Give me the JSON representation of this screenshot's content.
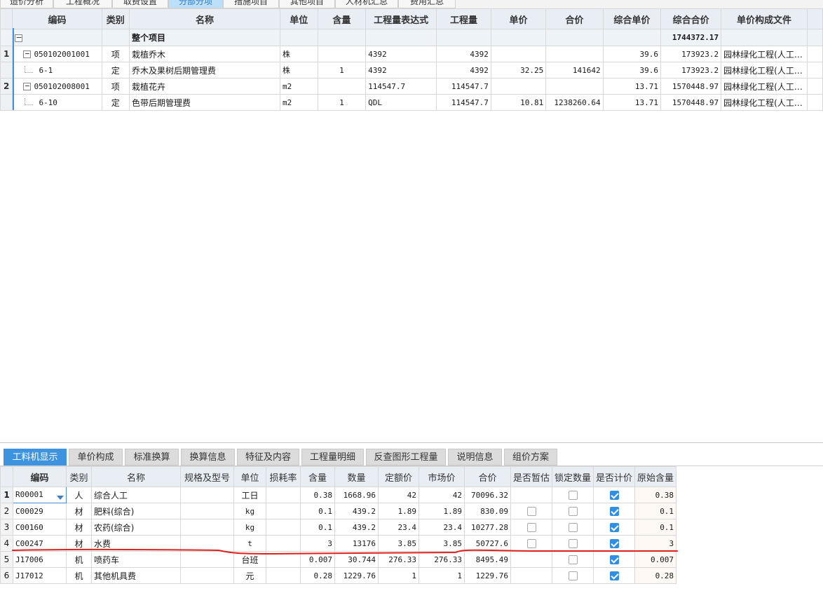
{
  "top_tabs": [
    {
      "label": "造价分析",
      "active": false
    },
    {
      "label": "工程概况",
      "active": false
    },
    {
      "label": "取费设置",
      "active": false
    },
    {
      "label": "分部分项",
      "active": true
    },
    {
      "label": "措施项目",
      "active": false
    },
    {
      "label": "其他项目",
      "active": false
    },
    {
      "label": "人材机汇总",
      "active": false
    },
    {
      "label": "费用汇总",
      "active": false
    }
  ],
  "main_grid": {
    "columns": [
      "编码",
      "类别",
      "名称",
      "单位",
      "含量",
      "工程量表达式",
      "工程量",
      "单价",
      "合价",
      "综合单价",
      "综合合价",
      "单价构成文件"
    ],
    "total_row": {
      "toggle": "−",
      "name": "整个项目",
      "total": "1744372.17"
    },
    "rows": [
      {
        "num": "1",
        "toggle": "−",
        "code": "050102001001",
        "type": "项",
        "name": "栽植乔木",
        "unit": "株",
        "content": "",
        "expr": "4392",
        "qty": "4392",
        "price": "",
        "amount": "",
        "unit_price": "39.6",
        "total": "173923.2",
        "file": "园林绿化工程(人工…"
      },
      {
        "num": "",
        "toggle": "",
        "code": "6-1",
        "type": "定",
        "name": "乔木及果树后期管理费",
        "unit": "株",
        "content": "1",
        "expr": "4392",
        "qty": "4392",
        "price": "32.25",
        "amount": "141642",
        "unit_price": "39.6",
        "total": "173923.2",
        "file": "园林绿化工程(人工…"
      },
      {
        "num": "2",
        "toggle": "−",
        "code": "050102008001",
        "type": "项",
        "name": "栽植花卉",
        "unit": "m2",
        "content": "",
        "expr": "114547.7",
        "qty": "114547.7",
        "price": "",
        "amount": "",
        "unit_price": "13.71",
        "total": "1570448.97",
        "file": "园林绿化工程(人工…"
      },
      {
        "num": "",
        "toggle": "",
        "code": "6-10",
        "type": "定",
        "name": "色带后期管理费",
        "unit": "m2",
        "content": "1",
        "expr": "QDL",
        "qty": "114547.7",
        "price": "10.81",
        "amount": "1238260.64",
        "unit_price": "13.71",
        "total": "1570448.97",
        "file": "园林绿化工程(人工…"
      }
    ]
  },
  "bottom_tabs": [
    {
      "label": "工料机显示",
      "active": true
    },
    {
      "label": "单价构成",
      "active": false
    },
    {
      "label": "标准换算",
      "active": false
    },
    {
      "label": "换算信息",
      "active": false
    },
    {
      "label": "特征及内容",
      "active": false
    },
    {
      "label": "工程量明细",
      "active": false
    },
    {
      "label": "反查图形工程量",
      "active": false
    },
    {
      "label": "说明信息",
      "active": false
    },
    {
      "label": "组价方案",
      "active": false
    }
  ],
  "detail_grid": {
    "columns": [
      "编码",
      "类别",
      "名称",
      "规格及型号",
      "单位",
      "损耗率",
      "含量",
      "数量",
      "定额价",
      "市场价",
      "合价",
      "是否暂估",
      "锁定数量",
      "是否计价",
      "原始含量"
    ],
    "rows": [
      {
        "num": "1",
        "code": "R00001",
        "type": "人",
        "name": "综合人工",
        "spec": "",
        "unit": "工日",
        "loss": "",
        "content": "0.38",
        "qty": "1668.96",
        "quota": "42",
        "market": "42",
        "amount": "70096.32",
        "est": null,
        "lock": false,
        "priced": true,
        "orig": "0.38"
      },
      {
        "num": "2",
        "code": "C00029",
        "type": "材",
        "name": "肥料(综合)",
        "spec": "",
        "unit": "kg",
        "loss": "",
        "content": "0.1",
        "qty": "439.2",
        "quota": "1.89",
        "market": "1.89",
        "amount": "830.09",
        "est": false,
        "lock": false,
        "priced": true,
        "orig": "0.1"
      },
      {
        "num": "3",
        "code": "C00160",
        "type": "材",
        "name": "农药(综合)",
        "spec": "",
        "unit": "kg",
        "loss": "",
        "content": "0.1",
        "qty": "439.2",
        "quota": "23.4",
        "market": "23.4",
        "amount": "10277.28",
        "est": false,
        "lock": false,
        "priced": true,
        "orig": "0.1"
      },
      {
        "num": "4",
        "code": "C00247",
        "type": "材",
        "name": "水费",
        "spec": "",
        "unit": "t",
        "loss": "",
        "content": "3",
        "qty": "13176",
        "quota": "3.85",
        "market": "3.85",
        "amount": "50727.6",
        "est": false,
        "lock": false,
        "priced": true,
        "orig": "3"
      },
      {
        "num": "5",
        "code": "J17006",
        "type": "机",
        "name": "喷药车",
        "spec": "",
        "unit": "台班",
        "loss": "",
        "content": "0.007",
        "qty": "30.744",
        "quota": "276.33",
        "market": "276.33",
        "amount": "8495.49",
        "est": null,
        "lock": false,
        "priced": true,
        "orig": "0.007"
      },
      {
        "num": "6",
        "code": "J17012",
        "type": "机",
        "name": "其他机具费",
        "spec": "",
        "unit": "元",
        "loss": "",
        "content": "0.28",
        "qty": "1229.76",
        "quota": "1",
        "market": "1",
        "amount": "1229.76",
        "est": null,
        "lock": false,
        "priced": true,
        "orig": "0.28"
      }
    ]
  },
  "colors": {
    "accent": "#3d93e0",
    "annotation": "#e0201c",
    "active_top_tab": "#bde0fa"
  }
}
